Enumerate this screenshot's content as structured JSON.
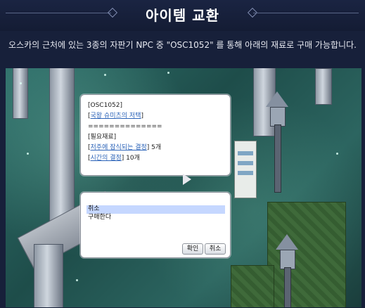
{
  "header": {
    "title": "아이템 교환",
    "subtitle": "오스카의 근처에 있는 3종의 자판기 NPC 중 \"OSC1052\" 를 통해 아래의 재료로 구매 가능합니다."
  },
  "npc_dialog": {
    "npc_name": "[OSC1052]",
    "item_link": "[국왕 슈미츠의 저택]",
    "separator": "==============",
    "materials_header": "[필요재료]",
    "material1_prefix": "[",
    "material1_link": "저주에 잠식되는 결정",
    "material1_suffix": "] 5개",
    "material2_prefix": "[",
    "material2_link": "시간의 결정",
    "material2_suffix": "] 10개"
  },
  "menu_dialog": {
    "items": [
      {
        "label": "취소",
        "selected": true
      },
      {
        "label": "구매한다",
        "selected": false
      }
    ],
    "ok_label": "확인",
    "cancel_label": "취소"
  },
  "colors": {
    "background": "#17203a",
    "link": "#2b63b8",
    "selection": "#c5d7ff"
  }
}
